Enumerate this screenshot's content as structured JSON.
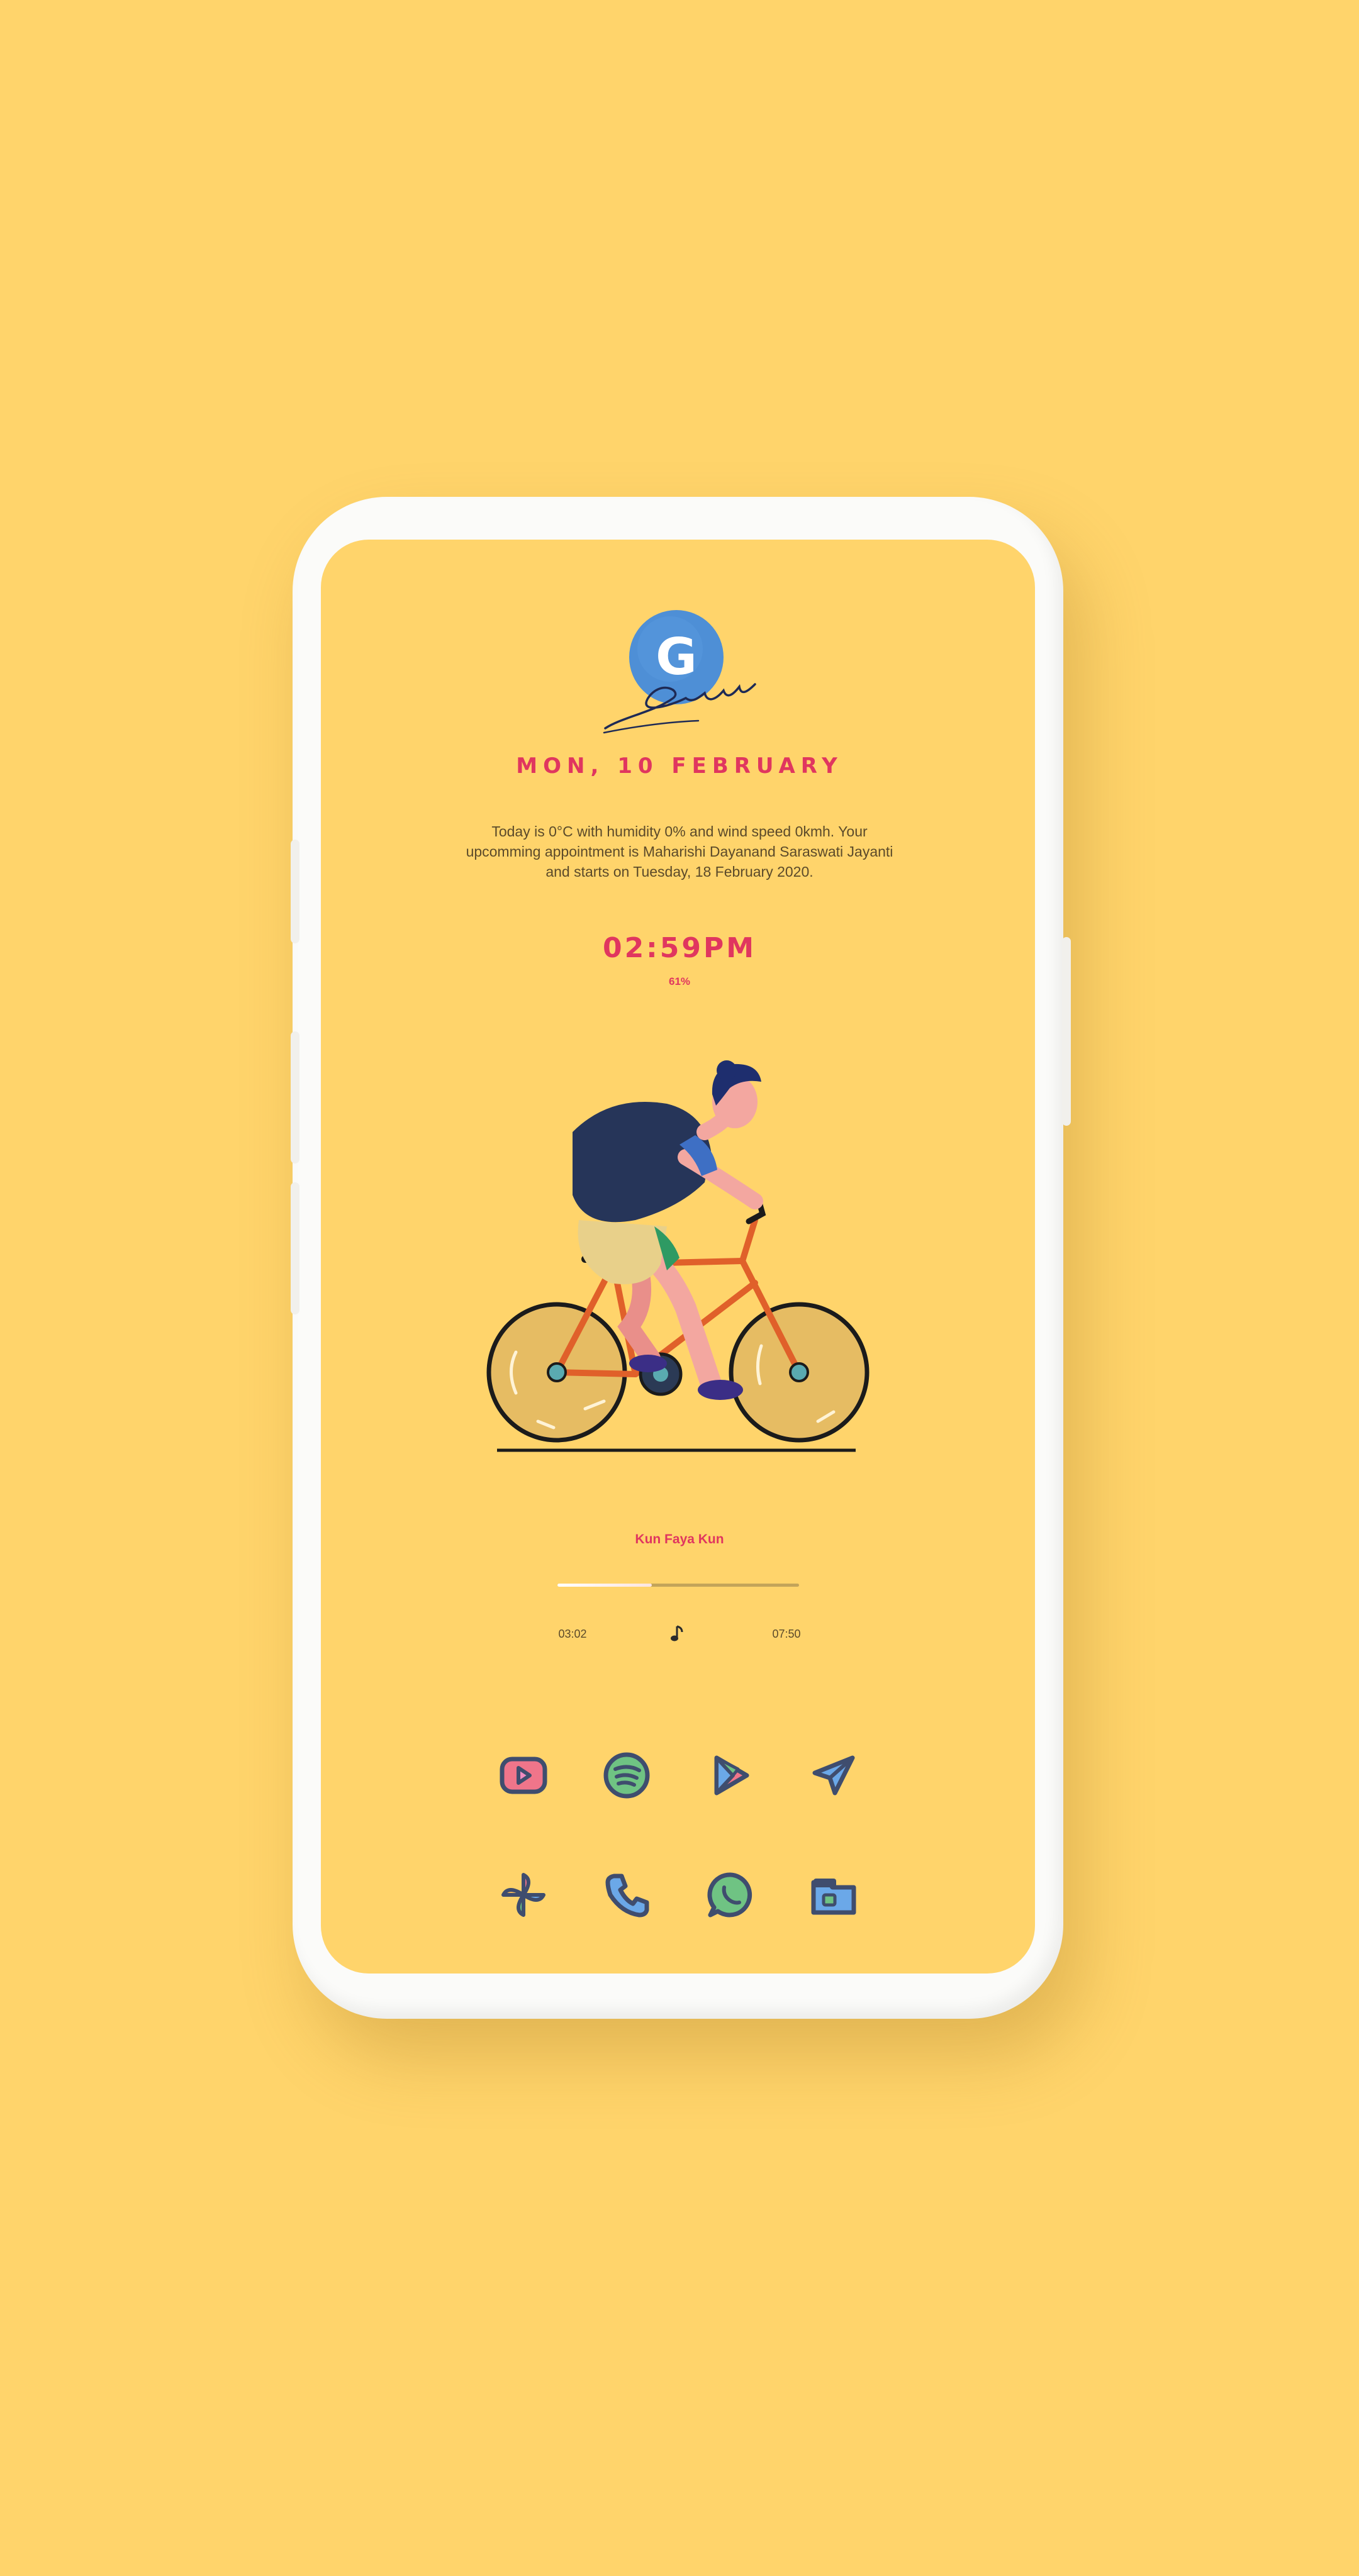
{
  "colors": {
    "background": "#FFD46B",
    "accent": "#E0365F",
    "text": "#5B4A2A",
    "icon_outline": "#3F4D6E",
    "google_blue": "#4E8FD6"
  },
  "search_widget": {
    "logo_letter": "G",
    "script_text": "Search"
  },
  "date": "MON, 10 FEBRUARY",
  "weather_text": "Today is  0°C with humidity 0% and wind speed 0kmh. Your upcomming appointment is Maharishi Dayanand Saraswati Jayanti and starts on Tuesday, 18 February 2020.",
  "clock": "02:59PM",
  "battery": "61%",
  "music": {
    "song_title": "Kun Faya Kun",
    "elapsed": "03:02",
    "duration": "07:50",
    "progress_fraction": 0.39,
    "note_icon": "music-note-icon"
  },
  "dock": {
    "row1": [
      {
        "name": "youtube",
        "icon": "youtube-icon"
      },
      {
        "name": "spotify",
        "icon": "spotify-icon"
      },
      {
        "name": "play-store",
        "icon": "play-store-icon"
      },
      {
        "name": "telegram",
        "icon": "telegram-icon"
      }
    ],
    "row2": [
      {
        "name": "pinwheel",
        "icon": "pinwheel-icon"
      },
      {
        "name": "phone",
        "icon": "phone-icon"
      },
      {
        "name": "whatsapp",
        "icon": "whatsapp-icon"
      },
      {
        "name": "files",
        "icon": "folder-icon"
      }
    ]
  }
}
